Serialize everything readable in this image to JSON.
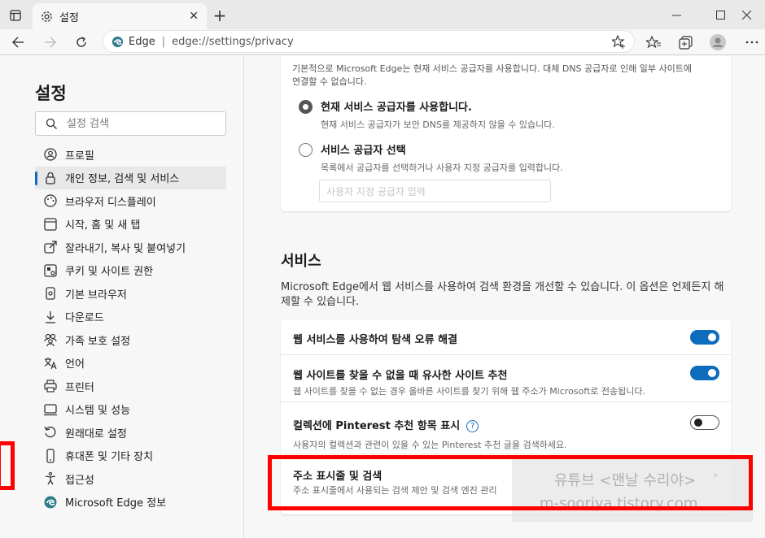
{
  "browser": {
    "tab_title": "설정",
    "tab_close": "✕",
    "new_tab": "+",
    "address_brand": "Edge",
    "address_sep": "|",
    "url": "edge://settings/privacy"
  },
  "sidebar": {
    "title": "설정",
    "search_placeholder": "설정 검색",
    "items": [
      {
        "label": "프로필",
        "icon": "profile-icon"
      },
      {
        "label": "개인 정보, 검색 및 서비스",
        "icon": "lock-icon",
        "active": true
      },
      {
        "label": "브라우저 디스플레이",
        "icon": "appearance-icon"
      },
      {
        "label": "시작, 홈 및 새 탭",
        "icon": "home-icon"
      },
      {
        "label": "잘라내기, 복사 및 붙여넣기",
        "icon": "share-icon"
      },
      {
        "label": "쿠키 및 사이트 권한",
        "icon": "cookie-icon"
      },
      {
        "label": "기본 브라우저",
        "icon": "browser-icon"
      },
      {
        "label": "다운로드",
        "icon": "download-icon"
      },
      {
        "label": "가족 보호 설정",
        "icon": "family-icon"
      },
      {
        "label": "언어",
        "icon": "language-icon"
      },
      {
        "label": "프린터",
        "icon": "printer-icon"
      },
      {
        "label": "시스템 및 성능",
        "icon": "system-icon"
      },
      {
        "label": "원래대로 설정",
        "icon": "reset-icon"
      },
      {
        "label": "휴대폰 및 기타 장치",
        "icon": "phone-icon"
      },
      {
        "label": "접근성",
        "icon": "accessibility-icon"
      },
      {
        "label": "Microsoft Edge 정보",
        "icon": "edge-icon"
      }
    ]
  },
  "main": {
    "dns_desc": "기본적으로 Microsoft Edge는 현재 서비스 공급자를 사용합니다. 대체 DNS 공급자로 인해 일부 사이트에 연결할 수 없습니다.",
    "dns_options": [
      {
        "title": "현재 서비스 공급자를 사용합니다.",
        "sub": "현재 서비스 공급자가 보안 DNS를 제공하지 않을 수 있습니다.",
        "checked": true
      },
      {
        "title": "서비스 공급자 선택",
        "sub": "목록에서 공급자를 선택하거나 사용자 지정 공급자를 입력합니다.",
        "checked": false
      }
    ],
    "dns_input_placeholder": "사용자 지정 공급자 입력",
    "services_title": "서비스",
    "services_desc": "Microsoft Edge에서 웹 서비스를 사용하여 검색 환경을 개선할 수 있습니다. 이 옵션은 언제든지 해제할 수 있습니다.",
    "rows": [
      {
        "title": "웹 서비스를 사용하여 탐색 오류 해결",
        "sub": "",
        "toggle": "on"
      },
      {
        "title": "웹 사이트를 찾을 수 없을 때 유사한 사이트 추천",
        "sub": "웹 사이트를 찾을 수 없는 경우 올바른 사이트를 찾기 위해 웹 주소가 Microsoft로 전송됩니다.",
        "toggle": "on"
      },
      {
        "title": "컬렉션에 Pinterest 추천 항목 표시",
        "sub": "사용자의 컬렉션과 관련이 있을 수 있는 Pinterest 추천 글을 검색하세요.",
        "toggle": "off"
      },
      {
        "title": "주소 표시줄 및 검색",
        "sub": "주소 표시줄에서 사용되는 검색 제안 및 검색 엔진 관리",
        "toggle": "chevron"
      }
    ],
    "help_glyph": "?",
    "chevron_glyph": "›"
  },
  "watermark": {
    "line1": "유튜브 <맨날 수리야>",
    "line2": "m-sooriya.tistory.com"
  },
  "colors": {
    "accent": "#0f6cbd",
    "highlight": "#ff0000"
  }
}
